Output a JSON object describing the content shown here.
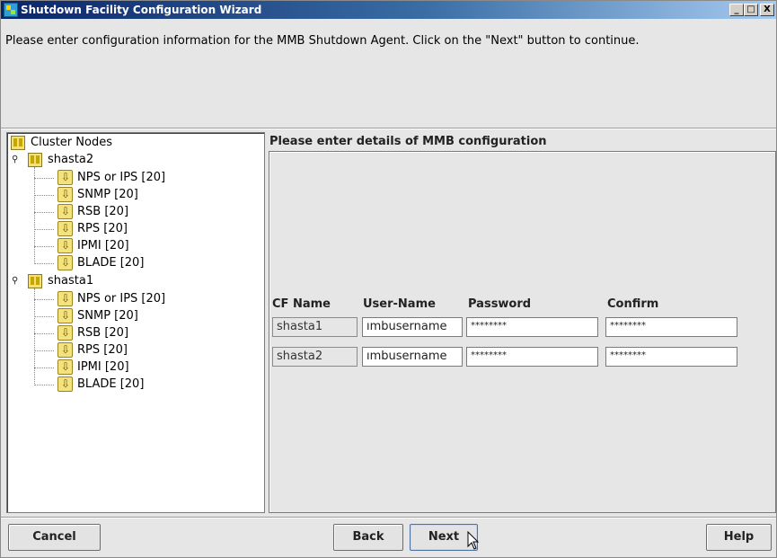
{
  "window": {
    "title": "Shutdown Facility Configuration Wizard",
    "minimize_glyph": "_",
    "maximize_glyph": "□",
    "close_glyph": "X"
  },
  "instructions": "Please enter configuration information for the MMB Shutdown Agent. Click on the \"Next\" button to continue.",
  "tree": {
    "root_label": "Cluster Nodes",
    "nodes": [
      {
        "label": "shasta2",
        "children": [
          "NPS or IPS [20]",
          "SNMP [20]",
          "RSB [20]",
          "RPS [20]",
          "IPMI [20]",
          "BLADE [20]"
        ]
      },
      {
        "label": "shasta1",
        "children": [
          "NPS or IPS [20]",
          "SNMP [20]",
          "RSB [20]",
          "RPS [20]",
          "IPMI [20]",
          "BLADE [20]"
        ]
      }
    ]
  },
  "details": {
    "title": "Please enter details of MMB configuration",
    "columns": [
      "CF Name",
      "User-Name",
      "Password",
      "Confirm"
    ],
    "rows": [
      {
        "cf_name": "shasta1",
        "user_name": "ımbusername",
        "password": "********",
        "confirm": "********"
      },
      {
        "cf_name": "shasta2",
        "user_name": "ımbusername",
        "password": "********",
        "confirm": "********"
      }
    ]
  },
  "buttons": {
    "cancel": "Cancel",
    "back": "Back",
    "next": "Next",
    "help": "Help"
  },
  "colors": {
    "titlebar_start": "#0a246a",
    "titlebar_end": "#a6caf0",
    "panel_bg": "#e6e6e6"
  }
}
